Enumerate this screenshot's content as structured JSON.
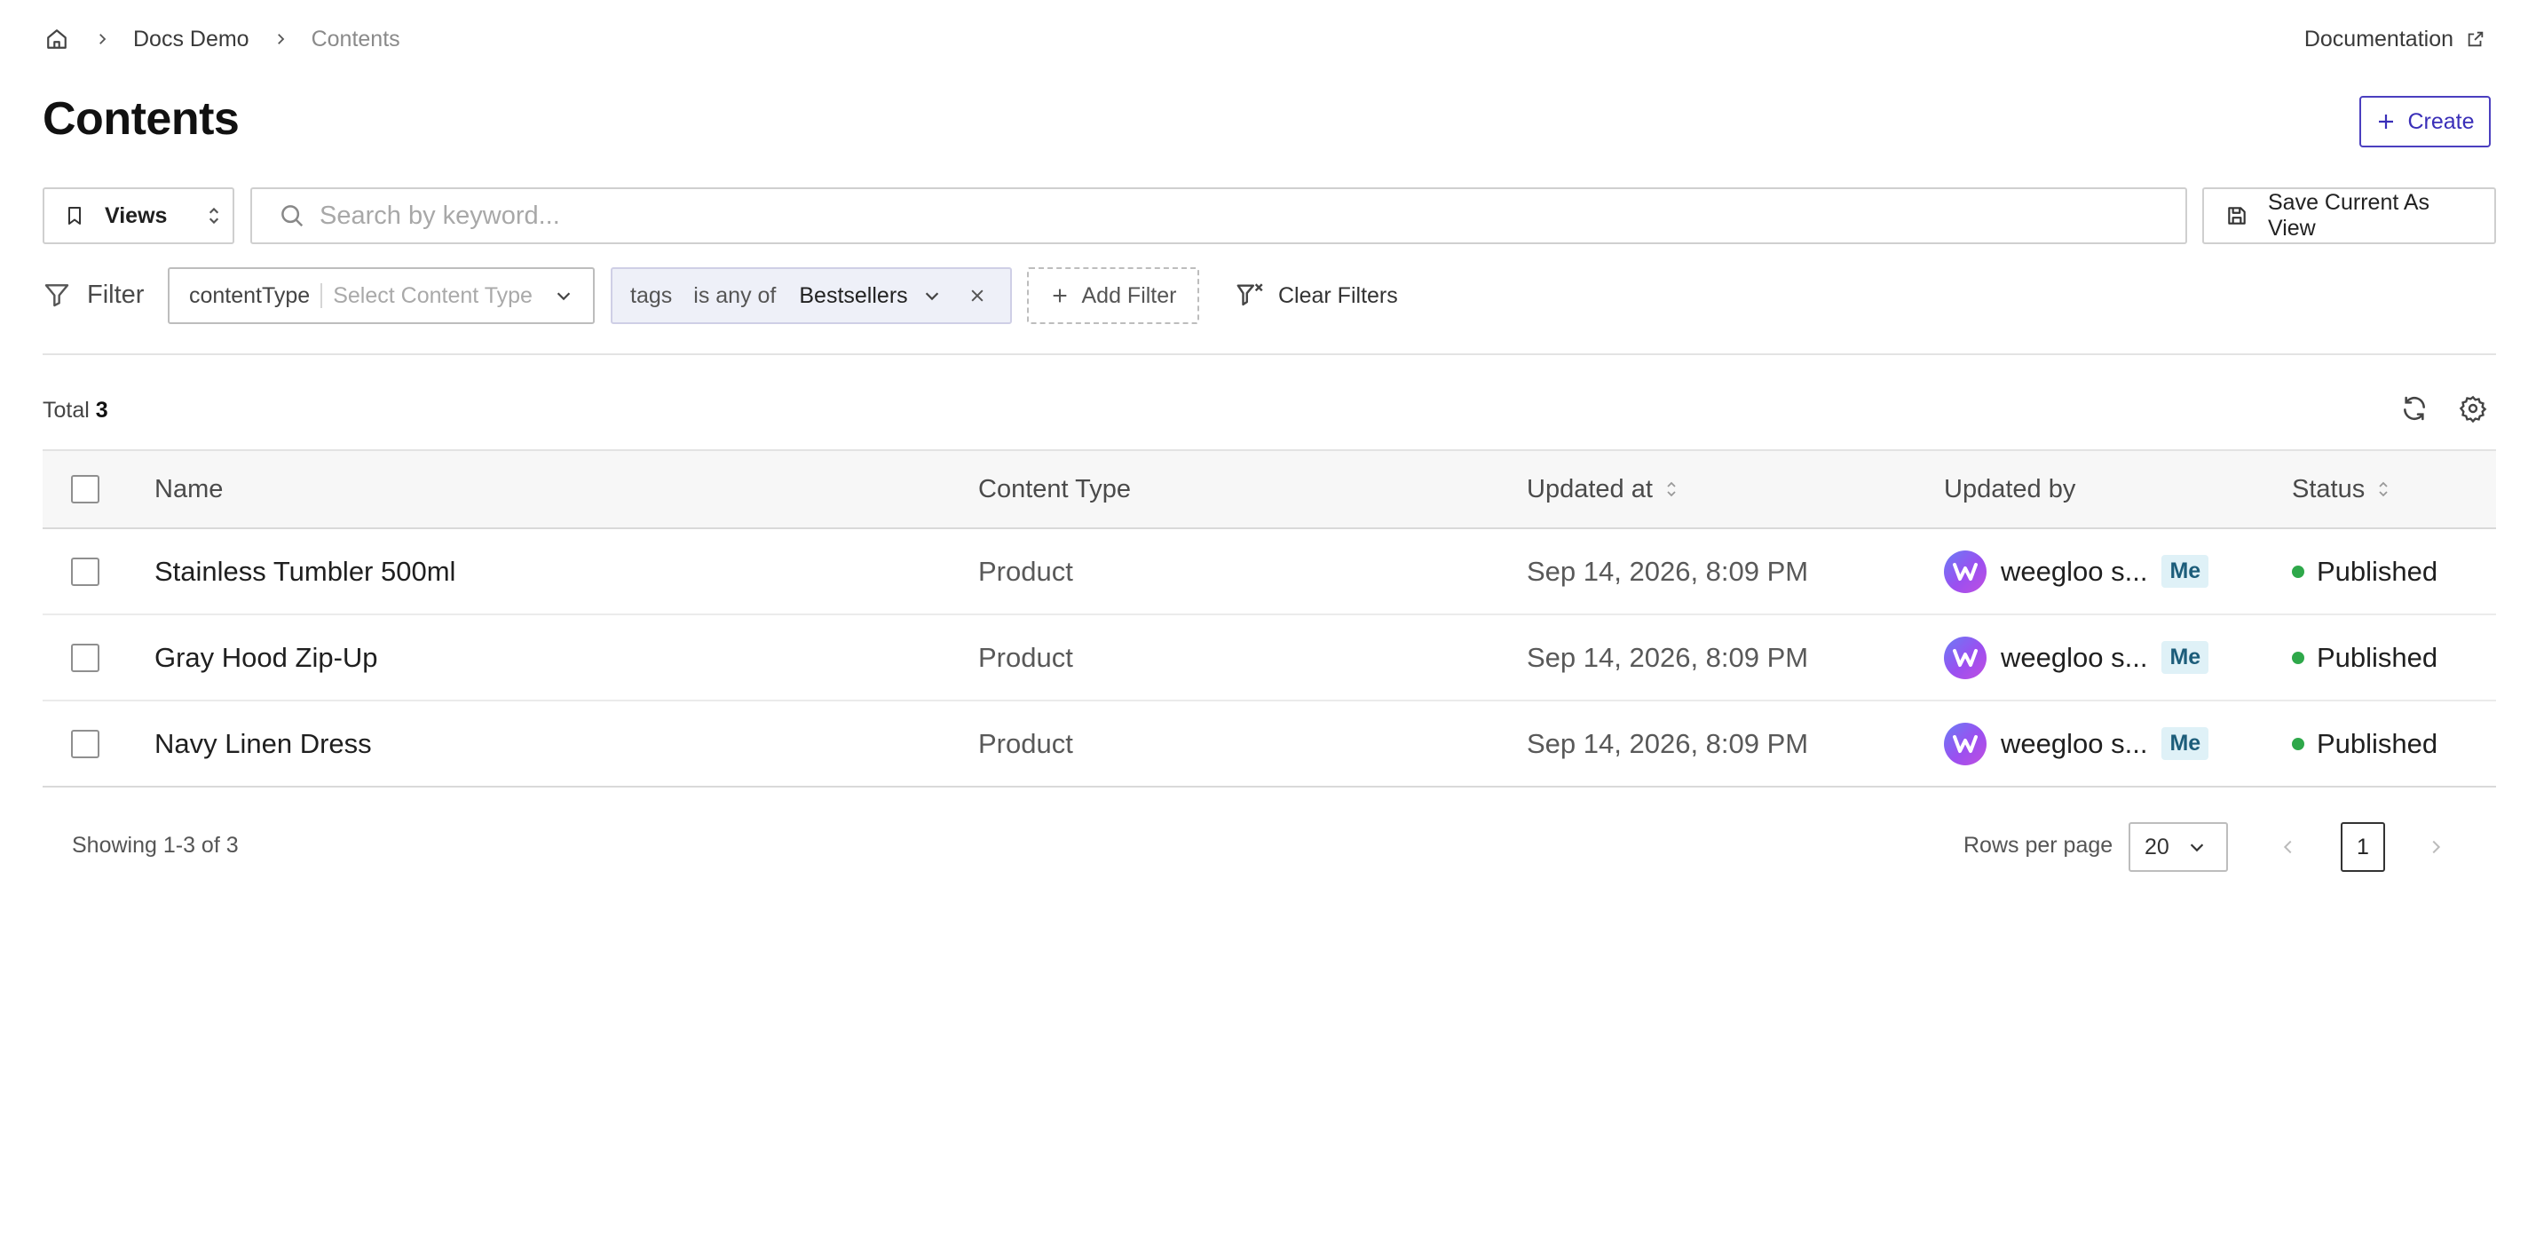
{
  "breadcrumb": {
    "home_icon": "home-icon",
    "items": [
      "Docs Demo",
      "Contents"
    ]
  },
  "header": {
    "documentation_label": "Documentation",
    "title": "Contents",
    "create_label": "Create"
  },
  "toolbar": {
    "views_label": "Views",
    "search_placeholder": "Search by keyword...",
    "search_value": "",
    "save_view_label": "Save Current As View"
  },
  "filters": {
    "filter_label": "Filter",
    "content_type": {
      "key": "contentType",
      "placeholder": "Select Content Type"
    },
    "tags": {
      "field": "tags",
      "operator": "is any of",
      "value": "Bestsellers"
    },
    "add_filter_label": "Add Filter",
    "clear_filters_label": "Clear Filters"
  },
  "summary": {
    "total_label": "Total",
    "total_count": "3"
  },
  "table": {
    "columns": [
      "Name",
      "Content Type",
      "Updated at",
      "Updated by",
      "Status"
    ],
    "rows": [
      {
        "name": "Stainless Tumbler 500ml",
        "content_type": "Product",
        "updated_at": "Sep 14, 2026, 8:09 PM",
        "updated_by": "weegloo s...",
        "me_badge": "Me",
        "status": "Published"
      },
      {
        "name": "Gray Hood Zip-Up",
        "content_type": "Product",
        "updated_at": "Sep 14, 2026, 8:09 PM",
        "updated_by": "weegloo s...",
        "me_badge": "Me",
        "status": "Published"
      },
      {
        "name": "Navy Linen Dress",
        "content_type": "Product",
        "updated_at": "Sep 14, 2026, 8:09 PM",
        "updated_by": "weegloo s...",
        "me_badge": "Me",
        "status": "Published"
      }
    ]
  },
  "pagination": {
    "showing_label": "Showing 1-3 of 3",
    "rows_per_page_label": "Rows per page",
    "rows_per_page_value": "20",
    "current_page": "1"
  },
  "colors": {
    "accent": "#3a2fb8",
    "published": "#2ea84a",
    "me_badge_bg": "#dff1f7"
  }
}
